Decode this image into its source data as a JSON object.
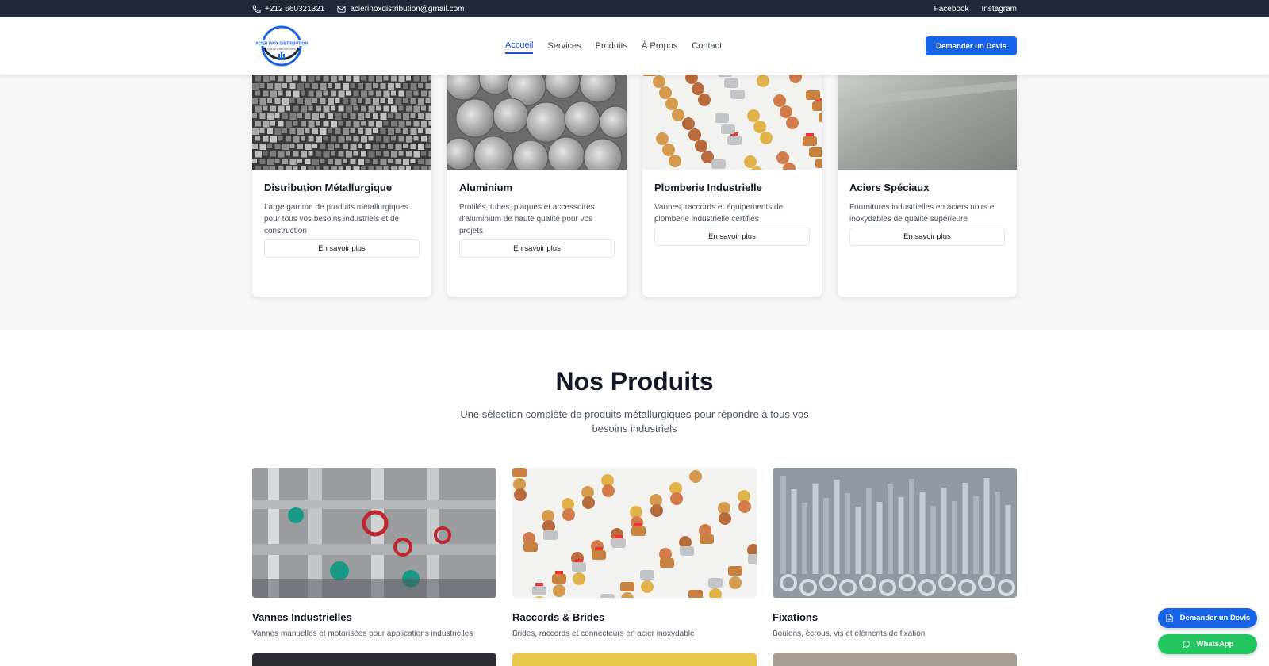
{
  "topbar": {
    "phone": "+212 660321321",
    "email": "acierinoxdistribution@gmail.com",
    "facebook": "Facebook",
    "instagram": "Instagram"
  },
  "header": {
    "logo_text": "ACIER INOX DISTRIBUTION",
    "logo_tagline": "SOLUTIONS MÉTAUX",
    "nav": [
      "Accueil",
      "Services",
      "Produits",
      "À Propos",
      "Contact"
    ],
    "active_nav": "Accueil",
    "cta": "Demander un Devis"
  },
  "services": [
    {
      "title": "Distribution Métallurgique",
      "desc": "Large gamme de produits métallurgiques pour tous vos besoins industriels et de construction",
      "button": "En savoir plus",
      "image": "steel-bars"
    },
    {
      "title": "Aluminium",
      "desc": "Profilés, tubes, plaques et accessoires d'aluminium de haute qualité pour vos projets",
      "button": "En savoir plus",
      "image": "aluminium-rods"
    },
    {
      "title": "Plomberie Industrielle",
      "desc": "Vannes, raccords et équipements de plomberie industrielle certifiés",
      "button": "En savoir plus",
      "image": "brass-fittings"
    },
    {
      "title": "Aciers Spéciaux",
      "desc": "Fournitures industrielles en aciers noirs et inoxydables de qualité supérieure",
      "button": "En savoir plus",
      "image": "steel-plate"
    }
  ],
  "products": {
    "title": "Nos Produits",
    "subtitle": "Une sélection complète de produits métallurgiques pour répondre à tous vos besoins industriels",
    "items": [
      {
        "name": "Vannes Industrielles",
        "desc": "Vannes manuelles et motorisées pour applications industrielles",
        "image": "industrial-valves"
      },
      {
        "name": "Raccords & Brides",
        "desc": "Brides, raccords et connecteurs en acier inoxydable",
        "image": "fittings"
      },
      {
        "name": "Fixations",
        "desc": "Boulons, écrous, vis et éléments de fixation",
        "image": "bolts"
      }
    ]
  },
  "floating": {
    "devis": "Demander un Devis",
    "whatsapp": "WhatsApp"
  },
  "colors": {
    "primary": "#1764e8",
    "topbar": "#1f2937",
    "whatsapp": "#22c55e"
  }
}
